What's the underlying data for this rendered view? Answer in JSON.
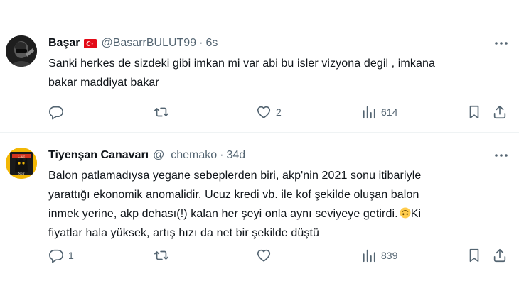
{
  "tweets": [
    {
      "name": "Başar",
      "handle": "@BasarrBULUT99",
      "separator": "·",
      "time": "6s",
      "lines": [
        "Sanki herkes de sizdeki gibi imkan mi var abi bu isler vizyona degil , imkana",
        "bakar maddiyat bakar"
      ],
      "replies": "",
      "retweets": "",
      "likes": "2",
      "views": "614"
    },
    {
      "name": "Tiyenşan Canavarı",
      "handle": "@_chemako",
      "separator": "·",
      "time": "34d",
      "lines": [
        "Balon patlamadıysa yegane sebeplerden biri, akp'nin 2021 sonu itibariyle",
        "yarattığı ekonomik anomalidir. Ucuz kredi vb. ile kof şekilde oluşan balon",
        "inmek yerine, akp dehası(!) kalan her şeyi onla aynı seviyeye getirdi.",
        "Ki",
        "fiyatlar hala yüksek, artış hızı da net bir şekilde düştü"
      ],
      "replies": "1",
      "retweets": "",
      "likes": "",
      "views": "839",
      "avatar_text": [
        "Chat",
        "Noir"
      ]
    }
  ],
  "icons": {
    "reply": "reply-icon",
    "retweet": "retweet-icon",
    "like": "heart-icon",
    "views": "views-icon",
    "bookmark": "bookmark-icon",
    "share": "share-icon",
    "more": "more-icon",
    "flag": "turkey-flag-icon",
    "emoji": "upside-down-face-emoji"
  },
  "colors": {
    "text": "#0f1419",
    "muted": "#536471",
    "flag_red": "#e30a17",
    "divider": "#eff3f4"
  }
}
